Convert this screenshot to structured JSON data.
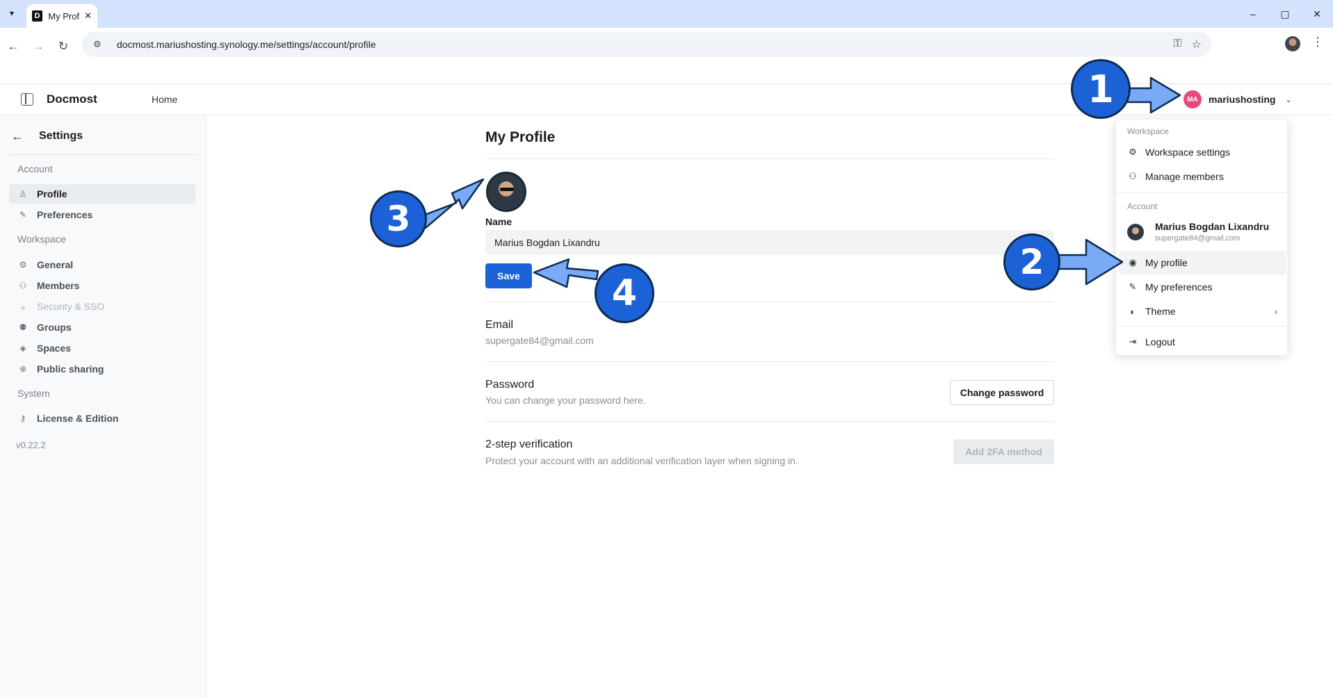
{
  "browser": {
    "tab_title": "My Profile",
    "tab_favicon": "D",
    "url": "docmost.mariushosting.synology.me/settings/account/profile",
    "window_controls": {
      "minimize": "–",
      "maximize": "▢",
      "close": "✕"
    }
  },
  "header": {
    "brand": "Docmost",
    "home": "Home",
    "user_initials": "MA",
    "username": "mariushosting"
  },
  "sidebar": {
    "title": "Settings",
    "sections": {
      "account": "Account",
      "workspace": "Workspace",
      "system": "System"
    },
    "items": [
      {
        "label": "Profile",
        "icon": "user-icon"
      },
      {
        "label": "Preferences",
        "icon": "brush-icon"
      },
      {
        "label": "General",
        "icon": "gear-icon"
      },
      {
        "label": "Members",
        "icon": "users-icon"
      },
      {
        "label": "Security & SSO",
        "icon": "lock-icon"
      },
      {
        "label": "Groups",
        "icon": "group-icon"
      },
      {
        "label": "Spaces",
        "icon": "spaces-icon"
      },
      {
        "label": "Public sharing",
        "icon": "globe-icon"
      },
      {
        "label": "License & Edition",
        "icon": "key-icon"
      }
    ],
    "version": "v0.22.2"
  },
  "main": {
    "title": "My Profile",
    "name_label": "Name",
    "name_value": "Marius Bogdan Lixandru",
    "save": "Save",
    "email_title": "Email",
    "email_value": "supergate84@gmail.com",
    "password_title": "Password",
    "password_sub": "You can change your password here.",
    "change_password": "Change password",
    "twofa_title": "2-step verification",
    "twofa_sub": "Protect your account with an additional verification layer when signing in.",
    "add_2fa": "Add 2FA method"
  },
  "dropdown": {
    "workspace_section": "Workspace",
    "workspace_settings": "Workspace settings",
    "manage_members": "Manage members",
    "account_section": "Account",
    "user_name": "Marius Bogdan Lixandru",
    "user_email": "supergate84@gmail.com",
    "my_profile": "My profile",
    "my_preferences": "My preferences",
    "theme": "Theme",
    "logout": "Logout"
  },
  "callouts": [
    "1",
    "2",
    "3",
    "4"
  ],
  "colors": {
    "primary": "#1c62d6",
    "callout_arrow": "#7aaaf5",
    "avatar_pink": "#e64980"
  }
}
